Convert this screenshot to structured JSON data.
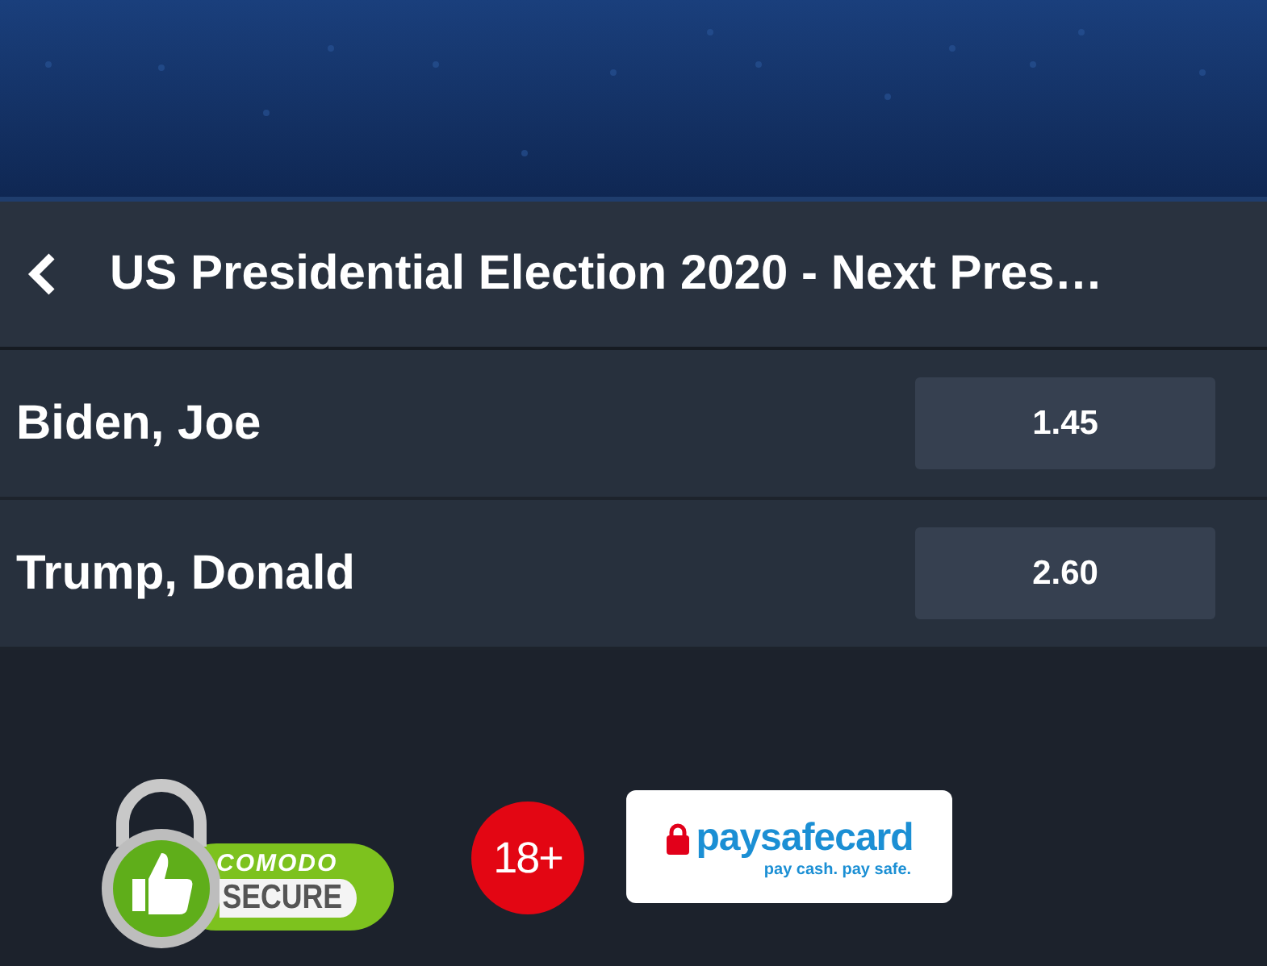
{
  "header": {
    "title": "US Presidential Election 2020 - Next Pres…"
  },
  "selections": [
    {
      "name": "Biden, Joe",
      "odds": "1.45"
    },
    {
      "name": "Trump, Donald",
      "odds": "2.60"
    }
  ],
  "footer": {
    "badges": [
      {
        "kind": "secure",
        "texts": [
          "COMODO",
          "SECURE"
        ]
      },
      {
        "kind": "age",
        "texts": [
          "18+"
        ]
      },
      {
        "kind": "payment",
        "texts": [
          "paysafecard",
          "pay cash. pay safe."
        ]
      }
    ]
  }
}
